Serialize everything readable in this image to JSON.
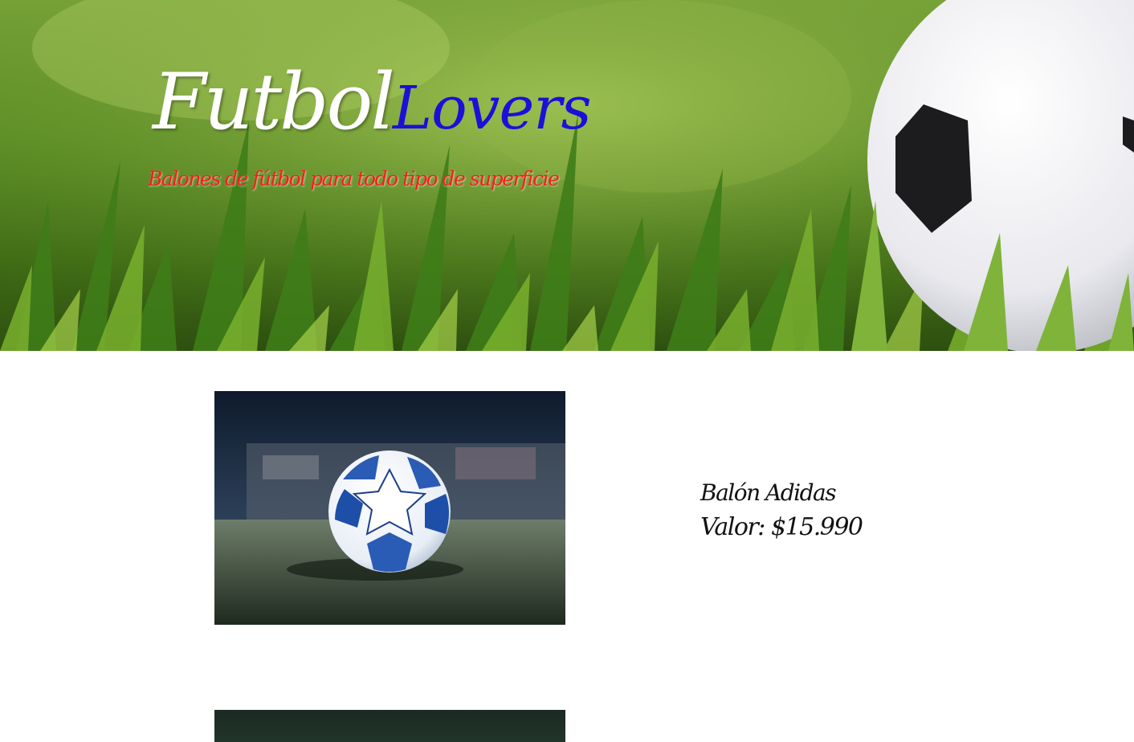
{
  "header": {
    "brand_part1": "Futbol",
    "brand_part2": "Lovers",
    "tagline": "Balones de fútbol para todo tipo de superficie"
  },
  "products": [
    {
      "name": "Balón Adidas",
      "price": "Valor: $15.990"
    }
  ],
  "colors": {
    "brand_white": "#ffffff",
    "brand_blue": "#1a10d8",
    "tagline_red": "#ff1a1a",
    "text_dark": "#111111"
  }
}
